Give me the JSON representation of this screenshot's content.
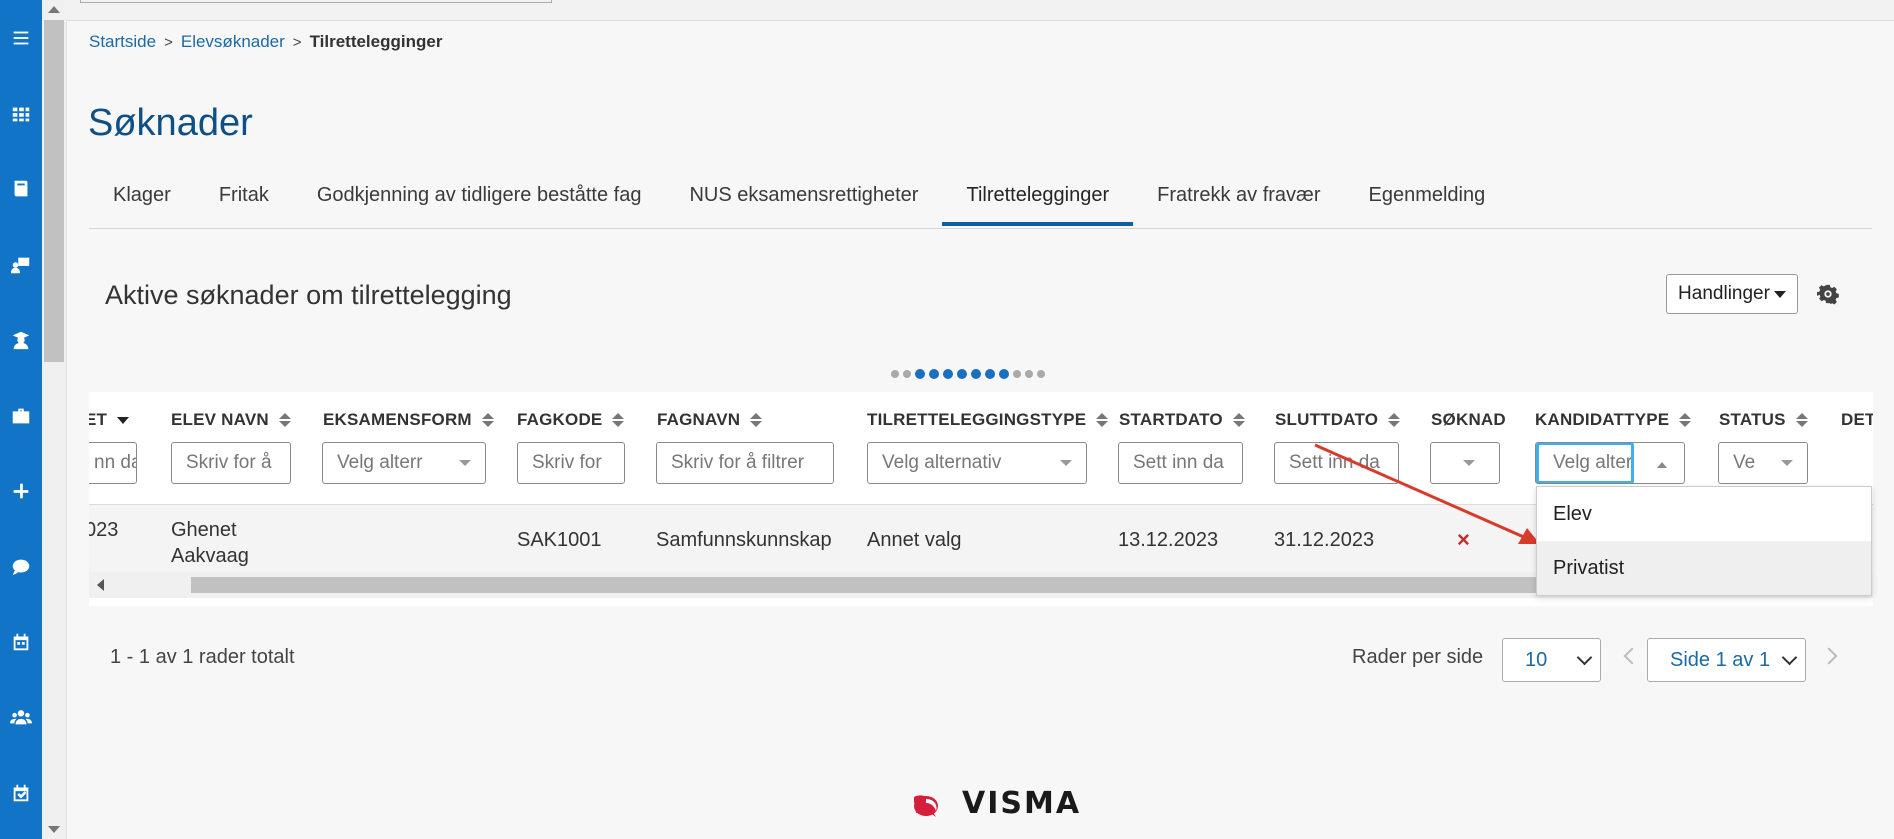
{
  "breadcrumb": {
    "home": "Startside",
    "parent": "Elevsøknader",
    "current": "Tilrettelegginger"
  },
  "page_title": "Søknader",
  "tabs": [
    "Klager",
    "Fritak",
    "Godkjenning av tidligere beståtte fag",
    "NUS eksamensrettigheter",
    "Tilrettelegginger",
    "Fratrekk av fravær",
    "Egenmelding"
  ],
  "active_tab": "Tilrettelegginger",
  "section_title": "Aktive søknader om tilrettelegging",
  "actions_label": "Handlinger",
  "columns": {
    "c0": "ET",
    "c1": "ELEV NAVN",
    "c2": "EKSAMENSFORM",
    "c3": "FAGKODE",
    "c4": "FAGNAVN",
    "c5": "TILRETTELEGGINGSTYPE",
    "c6": "STARTDATO",
    "c7": "SLUTTDATO",
    "c8": "SØKNAD",
    "c9": "KANDIDATTYPE",
    "c10": "STATUS",
    "c11": "DET"
  },
  "filters": {
    "f0": "nn da",
    "f1": "Skriv for å",
    "f2": "Velg alterr",
    "f3": "Skriv for",
    "f4": "Skriv for å filtrer",
    "f5": "Velg alternativ",
    "f6": "Sett inn da",
    "f7": "Sett inn da",
    "f9": "Velg alter",
    "f10": "Ve"
  },
  "row": {
    "date_partial": "023",
    "elev_first": "Ghenet",
    "elev_last": "Aakvaag",
    "fagkode": "SAK1001",
    "fagnavn": "Samfunnskunnskap",
    "type": "Annet valg",
    "start": "13.12.2023",
    "slutt": "31.12.2023",
    "soknad": "×"
  },
  "dropdown_options": [
    "Elev",
    "Privatist"
  ],
  "pager": {
    "info": "1 - 1 av 1 rader totalt",
    "rows_label": "Rader per side",
    "rows_value": "10",
    "page_value": "Side 1 av 1"
  },
  "logo_text": "VISMA",
  "colors": {
    "sidebar": "#1174c6",
    "title": "#0d4f86",
    "link": "#1b6aa5",
    "accent": "#0d5fa0",
    "error": "#c12d2d"
  },
  "carousel": {
    "total": 12,
    "active_from": 2,
    "active_to": 8
  }
}
